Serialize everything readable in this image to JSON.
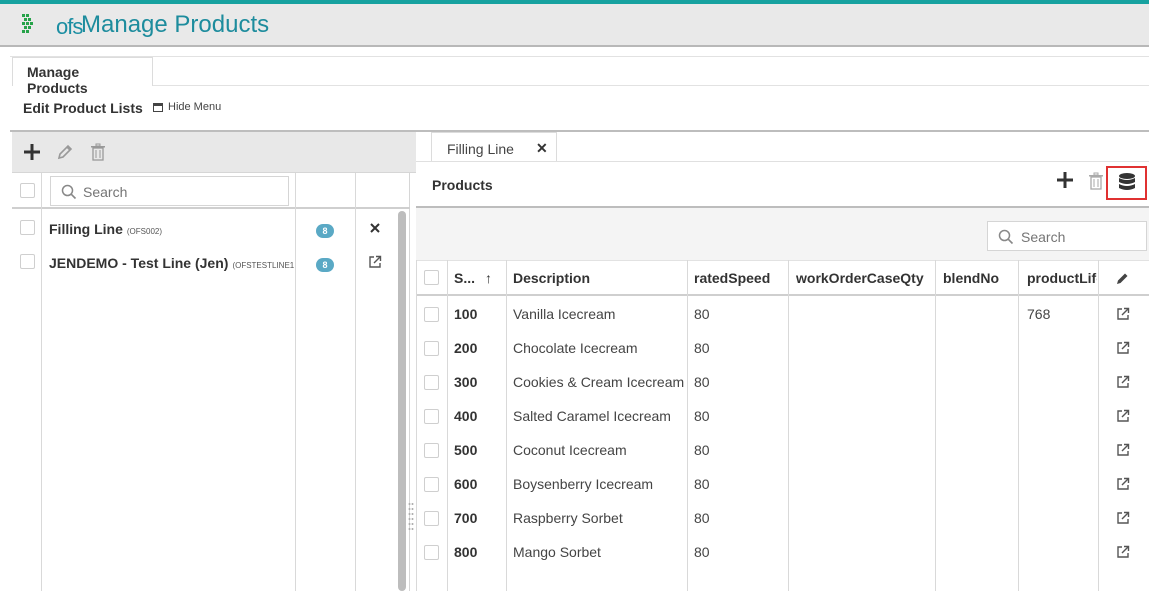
{
  "header": {
    "logo_text": "ofs",
    "title": "Manage Products"
  },
  "tabs": {
    "manage": "Manage Products"
  },
  "subheader": {
    "edit_lists": "Edit Product Lists",
    "hide_menu": "Hide Menu"
  },
  "left_panel": {
    "search_placeholder": "Search",
    "items": [
      {
        "name": "Filling Line",
        "code": "(OFS002)",
        "count": "8",
        "action_icon": "close-icon"
      },
      {
        "name": "JENDEMO - Test Line (Jen)",
        "code": "(OFSTESTLINE1",
        "count": "8",
        "action_icon": "open-external-icon"
      }
    ]
  },
  "right_panel": {
    "tab_label": "Filling Line",
    "title": "Products",
    "search_placeholder": "Search",
    "columns": [
      "S...",
      "Description",
      "ratedSpeed",
      "workOrderCaseQty",
      "blendNo",
      "productLife"
    ],
    "sort_indicator": "↑",
    "rows": [
      {
        "sku": "100",
        "description": "Vanilla Icecream",
        "ratedSpeed": "80",
        "workOrderCaseQty": "",
        "blendNo": "",
        "productLife": "768"
      },
      {
        "sku": "200",
        "description": "Chocolate Icecream",
        "ratedSpeed": "80",
        "workOrderCaseQty": "",
        "blendNo": "",
        "productLife": ""
      },
      {
        "sku": "300",
        "description": "Cookies & Cream Icecream",
        "ratedSpeed": "80",
        "workOrderCaseQty": "",
        "blendNo": "",
        "productLife": ""
      },
      {
        "sku": "400",
        "description": "Salted Caramel Icecream",
        "ratedSpeed": "80",
        "workOrderCaseQty": "",
        "blendNo": "",
        "productLife": ""
      },
      {
        "sku": "500",
        "description": "Coconut Icecream",
        "ratedSpeed": "80",
        "workOrderCaseQty": "",
        "blendNo": "",
        "productLife": ""
      },
      {
        "sku": "600",
        "description": "Boysenberry Icecream",
        "ratedSpeed": "80",
        "workOrderCaseQty": "",
        "blendNo": "",
        "productLife": ""
      },
      {
        "sku": "700",
        "description": "Raspberry Sorbet",
        "ratedSpeed": "80",
        "workOrderCaseQty": "",
        "blendNo": "",
        "productLife": ""
      },
      {
        "sku": "800",
        "description": "Mango Sorbet",
        "ratedSpeed": "80",
        "workOrderCaseQty": "",
        "blendNo": "",
        "productLife": ""
      }
    ]
  },
  "colors": {
    "brand_teal": "#1d8c9d",
    "accent_bar": "#17a2a0",
    "badge_blue": "#5aa9c5",
    "highlight_red": "#e03131"
  }
}
